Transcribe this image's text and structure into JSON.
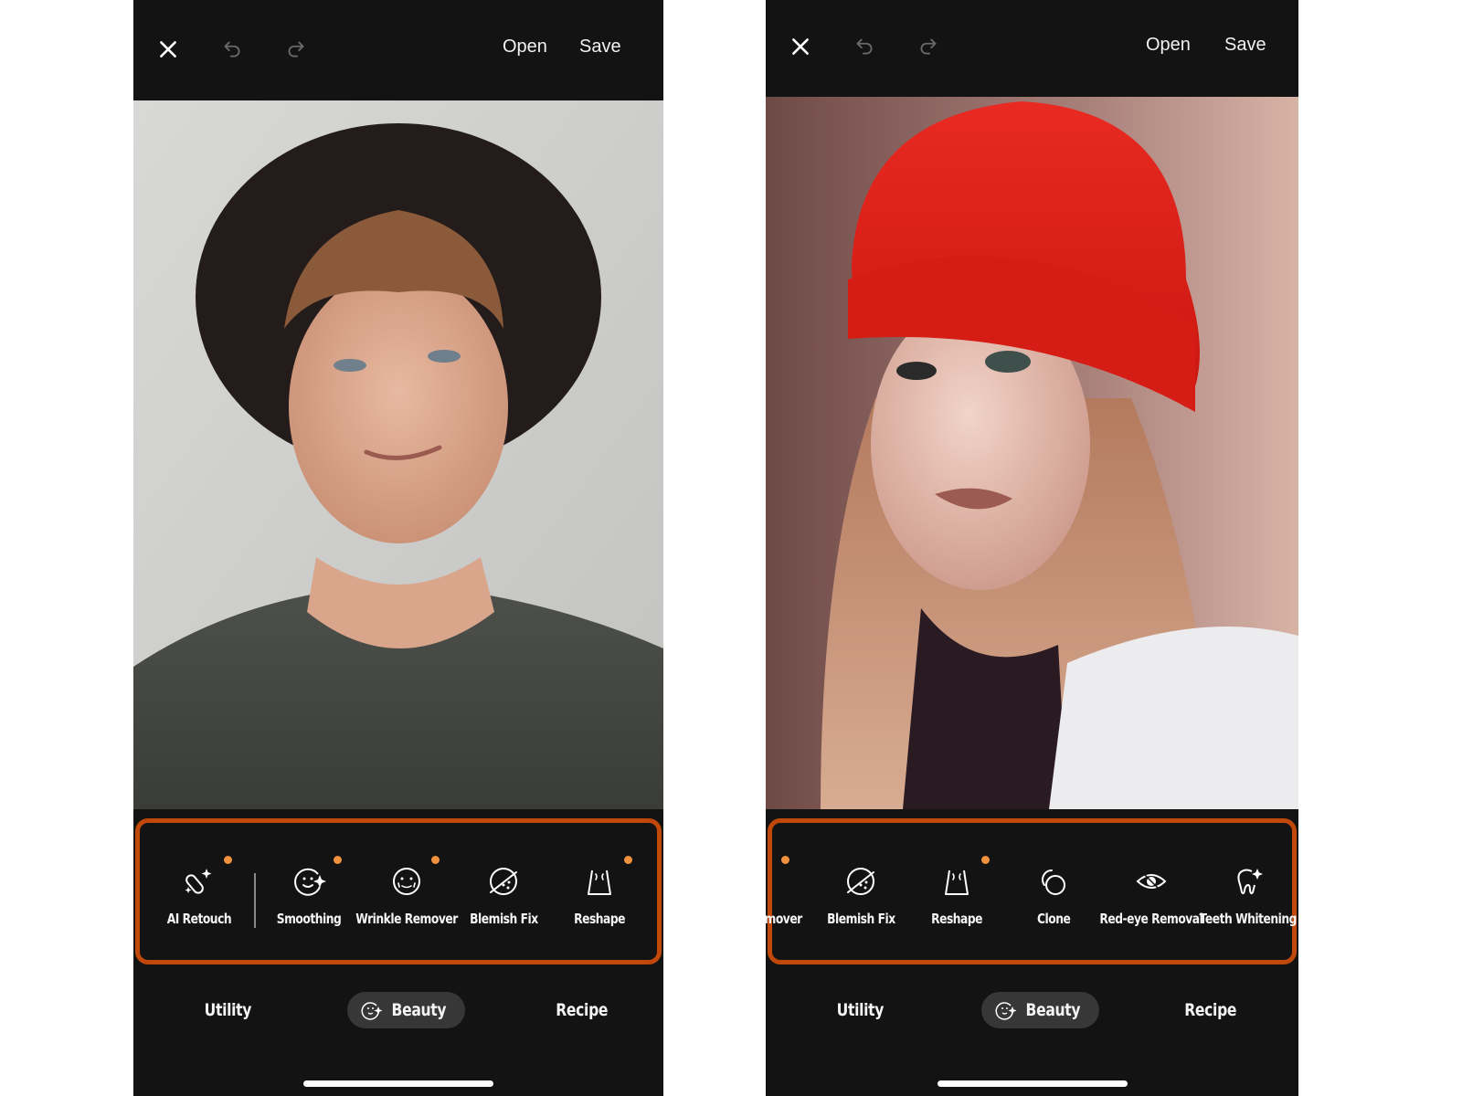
{
  "screens": [
    {
      "id": "left",
      "topbar": {
        "close_icon": "close-icon",
        "undo_icon": "undo-icon",
        "redo_icon": "redo-icon",
        "open_label": "Open",
        "save_label": "Save"
      },
      "photo": {
        "subject": "Young man with curly hair wearing a black wide-brim hat and dark green t-shirt against a light grey wall"
      },
      "tools": [
        {
          "label": "AI Retouch",
          "icon": "ai-retouch-icon",
          "new_dot": true
        },
        {
          "label": "Smoothing",
          "icon": "smoothing-icon",
          "new_dot": true
        },
        {
          "label": "Wrinkle Remover",
          "icon": "wrinkle-remover-icon",
          "new_dot": true
        },
        {
          "label": "Blemish Fix",
          "icon": "blemish-fix-icon",
          "new_dot": false
        },
        {
          "label": "Reshape",
          "icon": "reshape-icon",
          "new_dot": true
        }
      ],
      "tabs": [
        {
          "label": "Utility",
          "active": false
        },
        {
          "label": "Beauty",
          "active": true,
          "icon": "beauty-face-icon"
        },
        {
          "label": "Recipe",
          "active": false
        }
      ]
    },
    {
      "id": "right",
      "topbar": {
        "close_icon": "close-icon",
        "undo_icon": "undo-icon",
        "redo_icon": "redo-icon",
        "open_label": "Open",
        "save_label": "Save"
      },
      "photo": {
        "subject": "Young woman with long blonde hair wearing a red knit beanie and white top"
      },
      "tools": [
        {
          "label": "mover",
          "icon": "",
          "new_dot": true,
          "truncated": true
        },
        {
          "label": "Blemish Fix",
          "icon": "blemish-fix-icon",
          "new_dot": false
        },
        {
          "label": "Reshape",
          "icon": "reshape-icon",
          "new_dot": true
        },
        {
          "label": "Clone",
          "icon": "clone-icon",
          "new_dot": false
        },
        {
          "label": "Red-eye Removal",
          "icon": "red-eye-icon",
          "new_dot": false
        },
        {
          "label": "Teeth Whitening",
          "icon": "teeth-whitening-icon",
          "new_dot": false
        }
      ],
      "tabs": [
        {
          "label": "Utility",
          "active": false
        },
        {
          "label": "Beauty",
          "active": true,
          "icon": "beauty-face-icon"
        },
        {
          "label": "Recipe",
          "active": false
        }
      ]
    }
  ],
  "colors": {
    "background": "#131313",
    "highlight_border": "#c0490a",
    "new_dot": "#f0913d",
    "active_tab": "#373737",
    "text": "#f5f5f5"
  }
}
